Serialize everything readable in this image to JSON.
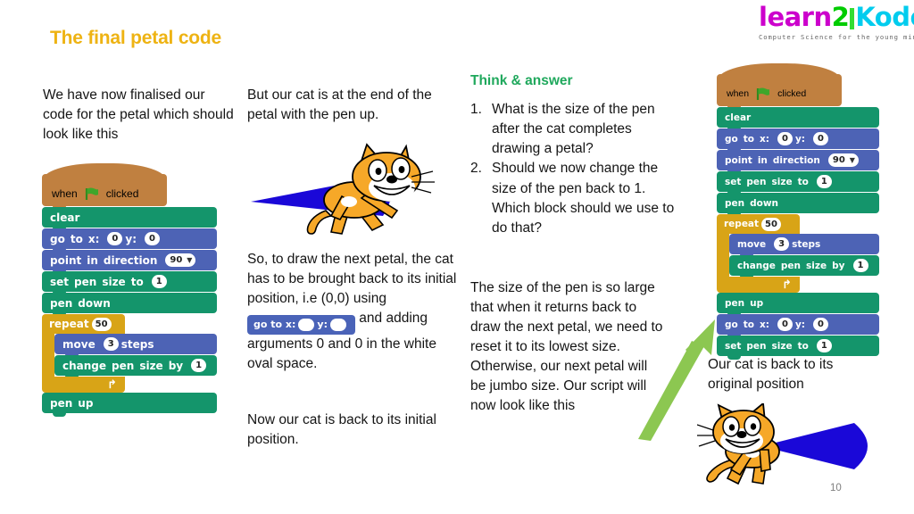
{
  "logo": {
    "part1": "learn",
    "part2": "2",
    "part3": "ode",
    "letter_k": "K",
    "tagline": "Computer Science for the young minds",
    "color_learn": "#cc00cc",
    "color_two": "#00cc00",
    "color_ode": "#00ccee"
  },
  "title": "The final petal code",
  "page_number": "10",
  "columns": {
    "col1": {
      "paragraph": "We have now finalised our code for the petal which should look like this"
    },
    "col2": {
      "paragraph1": "But our cat is at the end of the petal with the pen up.",
      "paragraph2_before": "So, to draw the next petal, the cat has to be brought back to its initial position, i.e (0,0) using",
      "paragraph2_after": "and adding arguments 0 and 0 in the white oval space.",
      "paragraph3": "Now our cat is back to its initial position."
    },
    "col3": {
      "heading": "Think & answer",
      "heading_color": "#1fa85c",
      "questions": [
        {
          "num": "1.",
          "text": "What is the size of the pen after the cat completes drawing a petal?"
        },
        {
          "num": "2.",
          "text": "Should we now change the size of the pen back to 1. Which block should we use to do that?"
        }
      ],
      "paragraph": "The size of the pen is so large that when it returns back to draw the next petal, we need to reset it to its lowest size. Otherwise, our next petal will be jumbo size. Our script will now look like this"
    },
    "col4": {
      "caption": "Our cat is back to its original position"
    }
  },
  "inline_block": {
    "label_goto": "go to x:",
    "label_y": "y:",
    "value_x": "",
    "value_y": "",
    "color": "#4a63b8"
  },
  "script_left": {
    "blocks": [
      {
        "type": "hat",
        "words": [
          "when",
          "FLAG",
          "clicked"
        ],
        "color": "#c08040"
      },
      {
        "type": "stack",
        "words": [
          "clear"
        ],
        "color": "#14956b"
      },
      {
        "type": "stack",
        "words": [
          "go",
          "to",
          "x:",
          "#0",
          "y:",
          "#0"
        ],
        "color": "#4d63b5"
      },
      {
        "type": "stack",
        "words": [
          "point",
          "in",
          "direction",
          "@90"
        ],
        "color": "#4d63b5"
      },
      {
        "type": "stack",
        "words": [
          "set",
          "pen",
          "size",
          "to",
          "#1"
        ],
        "color": "#14956b"
      },
      {
        "type": "stack",
        "words": [
          "pen",
          "down"
        ],
        "color": "#14956b"
      },
      {
        "type": "c",
        "words": [
          "repeat",
          "#50"
        ],
        "color": "#d8a417",
        "children": [
          {
            "type": "stack",
            "words": [
              "move",
              "#3",
              "steps"
            ],
            "color": "#4d63b5"
          },
          {
            "type": "stack",
            "words": [
              "change",
              "pen",
              "size",
              "by",
              "#1"
            ],
            "color": "#14956b"
          }
        ]
      },
      {
        "type": "stack",
        "words": [
          "pen",
          "up"
        ],
        "color": "#14956b"
      }
    ]
  },
  "script_right": {
    "blocks": [
      {
        "type": "hat",
        "words": [
          "when",
          "FLAG",
          "clicked"
        ],
        "color": "#c08040"
      },
      {
        "type": "stack",
        "words": [
          "clear"
        ],
        "color": "#14956b"
      },
      {
        "type": "stack",
        "words": [
          "go",
          "to",
          "x:",
          "#0",
          "y:",
          "#0"
        ],
        "color": "#4d63b5"
      },
      {
        "type": "stack",
        "words": [
          "point",
          "in",
          "direction",
          "@90"
        ],
        "color": "#4d63b5"
      },
      {
        "type": "stack",
        "words": [
          "set",
          "pen",
          "size",
          "to",
          "#1"
        ],
        "color": "#14956b"
      },
      {
        "type": "stack",
        "words": [
          "pen",
          "down"
        ],
        "color": "#14956b"
      },
      {
        "type": "c",
        "words": [
          "repeat",
          "#50"
        ],
        "color": "#d8a417",
        "children": [
          {
            "type": "stack",
            "words": [
              "move",
              "#3",
              "steps"
            ],
            "color": "#4d63b5"
          },
          {
            "type": "stack",
            "words": [
              "change",
              "pen",
              "size",
              "by",
              "#1"
            ],
            "color": "#14956b"
          }
        ]
      },
      {
        "type": "stack",
        "words": [
          "pen",
          "up"
        ],
        "color": "#14956b"
      },
      {
        "type": "stack",
        "words": [
          "go",
          "to",
          "x:",
          "#0",
          "y:",
          "#0"
        ],
        "color": "#4d63b5"
      },
      {
        "type": "stack",
        "words": [
          "set",
          "pen",
          "size",
          "to",
          "#1"
        ],
        "color": "#14956b"
      }
    ]
  },
  "artwork": {
    "petal_color": "#1a08d8",
    "cat_color": "#f49b28",
    "arrow_color": "#8cc751"
  }
}
